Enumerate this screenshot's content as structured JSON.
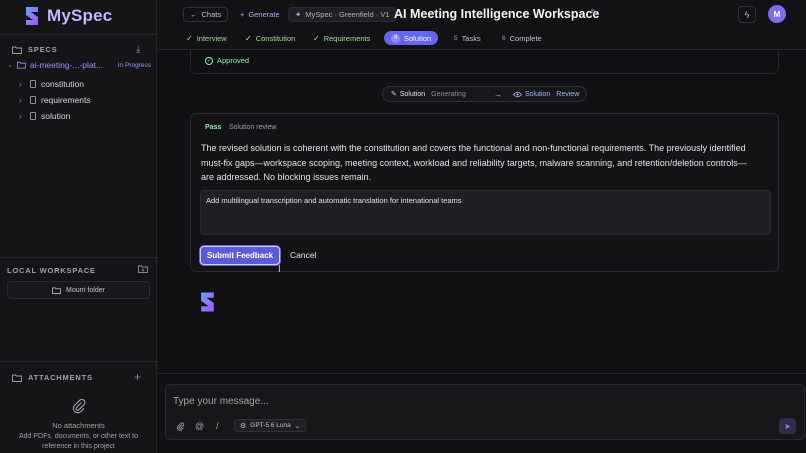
{
  "app": {
    "name": "MySpec"
  },
  "sidebar": {
    "specs_header": "SPECS",
    "project": {
      "name": "ai-meeting-...-plat...",
      "status": "In Progress"
    },
    "tree": [
      {
        "label": "constitution"
      },
      {
        "label": "requirements"
      },
      {
        "label": "solution"
      }
    ],
    "workspace_header": "LOCAL WORKSPACE",
    "mount_label": "Mount folder",
    "attachments_header": "ATTACHMENTS",
    "no_attachments": "No attachments",
    "attach_hint": "Add PDFs, documents, or other text to reference in this project"
  },
  "header": {
    "chats_label": "Chats",
    "generate_label": "Generate",
    "context_label": "MySpec · Greenfield · V1",
    "title": "AI Meeting Intelligence Workspace",
    "avatar_initial": "M",
    "steps": [
      {
        "label": "Interview",
        "state": "done"
      },
      {
        "label": "Constitution",
        "state": "done"
      },
      {
        "label": "Requirements",
        "state": "done"
      },
      {
        "num": "4",
        "label": "Solution",
        "state": "active"
      },
      {
        "num": "5",
        "label": "Tasks",
        "state": "todo"
      },
      {
        "num": "6",
        "label": "Complete",
        "state": "todo"
      }
    ]
  },
  "main": {
    "approved_label": "Approved",
    "flow": {
      "from_label": "Solution",
      "from_sub": "Generating",
      "to_label": "Solution",
      "to_sub": "Review"
    },
    "review": {
      "badge": "Pass",
      "label": "Solution review",
      "text": "The revised solution is coherent with the constitution and covers the functional and non-functional requirements. The previously identified must-fix gaps—workspace scoping, meeting context, workload and reliability targets, malware scanning, and retention/deletion controls—are addressed. No blocking issues remain.",
      "feedback_value": "Add multilingual transcription and automatic translation for intenational teams",
      "submit_label": "Submit Feedback",
      "cancel_label": "Cancel"
    }
  },
  "composer": {
    "placeholder": "Type your message...",
    "model_label": "GPT-5.6 Luna"
  },
  "colors": {
    "accent": "#6366f1",
    "success": "#86efac",
    "brand": "#a78bfa"
  }
}
